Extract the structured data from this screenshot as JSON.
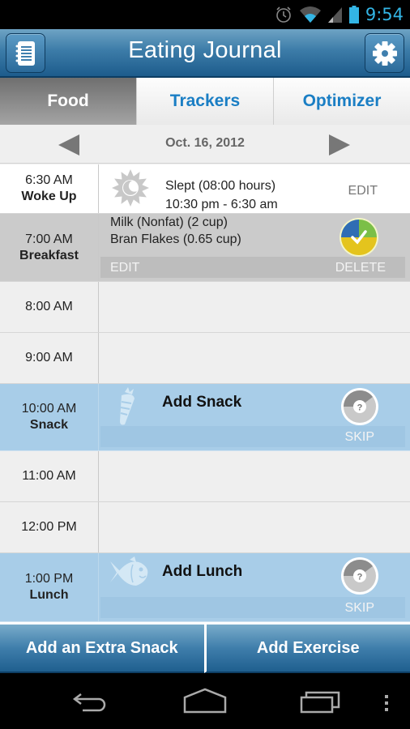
{
  "status_bar": {
    "time": "9:54",
    "icons": [
      "alarm-icon",
      "wifi-icon",
      "signal-icon",
      "battery-icon"
    ]
  },
  "header": {
    "title": "Eating Journal",
    "left_button_icon": "notebook-icon",
    "right_button_icon": "gear-icon"
  },
  "tabs": [
    {
      "label": "Food",
      "active": true
    },
    {
      "label": "Trackers",
      "active": false
    },
    {
      "label": "Optimizer",
      "active": false
    }
  ],
  "date_nav": {
    "date": "Oct. 16, 2012",
    "prev_icon": "triangle-left-icon",
    "next_icon": "triangle-right-icon"
  },
  "timeline": {
    "wake": {
      "time": "6:30 AM",
      "label": "Woke Up",
      "icon": "sun-moon-icon",
      "line1": "Slept (08:00 hours)",
      "line2": "10:30 pm - 6:30 am",
      "edit_label": "EDIT"
    },
    "breakfast": {
      "time": "7:00 AM",
      "label": "Breakfast",
      "items": [
        "Milk (Nonfat) (2 cup)",
        "Bran Flakes (0.65 cup)"
      ],
      "status_icon": "completed-check-donut-icon",
      "edit_label": "EDIT",
      "delete_label": "DELETE"
    },
    "empty_slots": [
      {
        "time": "8:00 AM"
      },
      {
        "time": "9:00 AM"
      },
      {
        "time": "11:00 AM"
      },
      {
        "time": "12:00 PM"
      }
    ],
    "snack": {
      "time": "10:00 AM",
      "label": "Snack",
      "title": "Add Snack",
      "icon": "carrot-icon",
      "status_icon": "question-donut-icon",
      "skip_label": "SKIP"
    },
    "lunch": {
      "time": "1:00 PM",
      "label": "Lunch",
      "title": "Add Lunch",
      "icon": "fish-icon",
      "status_icon": "question-donut-icon",
      "skip_label": "SKIP"
    }
  },
  "bottom_buttons": {
    "extra_snack": "Add an Extra Snack",
    "exercise": "Add Exercise"
  },
  "colors": {
    "accent_blue": "#1a7ec4",
    "header_blue": "#3c7ca8",
    "meal_row_blue": "#a8cde8",
    "status_blue": "#33b5e5"
  }
}
